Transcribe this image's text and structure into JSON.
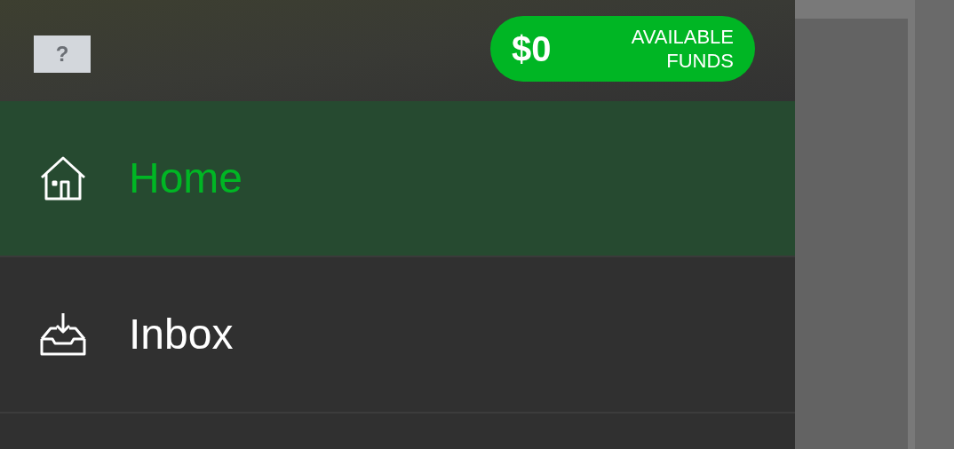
{
  "header": {
    "help_button": "?",
    "balance": {
      "amount": "$0",
      "label": "AVAILABLE FUNDS"
    }
  },
  "menu": [
    {
      "label": "Home",
      "kind": "home",
      "selected": true
    },
    {
      "label": "Inbox",
      "kind": "inbox",
      "selected": false
    }
  ]
}
